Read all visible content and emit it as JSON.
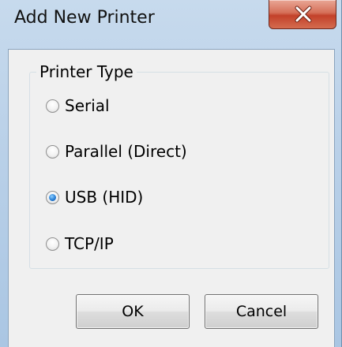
{
  "window": {
    "title": "Add New Printer",
    "close_label": "×"
  },
  "printer_type": {
    "label": "Printer Type",
    "options": [
      {
        "label": "Serial",
        "selected": false
      },
      {
        "label": "Parallel (Direct)",
        "selected": false
      },
      {
        "label": "USB (HID)",
        "selected": true
      },
      {
        "label": "TCP/IP",
        "selected": false
      }
    ]
  },
  "buttons": {
    "ok": "OK",
    "cancel": "Cancel"
  }
}
